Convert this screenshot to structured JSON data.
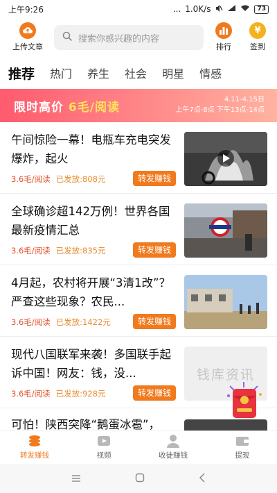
{
  "status_bar": {
    "time": "上午9:26",
    "dots": "...",
    "speed": "1.0K/s",
    "battery": "73"
  },
  "header": {
    "upload_label": "上传文章",
    "search_placeholder": "搜索你感兴趣的内容",
    "rank_label": "排行",
    "sign_label": "签到",
    "sign_symbol": "¥"
  },
  "tabs": [
    "推荐",
    "热门",
    "养生",
    "社会",
    "明星",
    "情感"
  ],
  "banner": {
    "text_prefix": "限时高价 ",
    "text_highlight": "6毛/阅读",
    "date_line": "4.11-4.15日",
    "time_line": "上午7点-8点 下午13点-14点"
  },
  "news": [
    {
      "title": "午间惊险一幕！电瓶车充电突发爆炸，起火",
      "price": "3.6毛/阅读",
      "sent": "已发放:808元",
      "share": "转发赚钱"
    },
    {
      "title": "全球确诊超142万例！世界各国最新疫情汇总",
      "price": "3.6毛/阅读",
      "sent": "已发放:835元",
      "share": "转发赚钱"
    },
    {
      "title": "4月起，农村将开展“3清1改”？严查这些现象？农民...",
      "price": "3.6毛/阅读",
      "sent": "已发放:1422元",
      "share": "转发赚钱"
    },
    {
      "title": "现代八国联军来袭！多国联手起诉中国！网友：钱，没...",
      "price": "3.6毛/阅读",
      "sent": "已发放:928元",
      "share": "转发赚钱",
      "thumb_text": "钱库资讯"
    }
  ],
  "partial_news_title": "可怕！陕西突降“鹅蛋冰雹”，",
  "bottom_nav": [
    "转发赚钱",
    "视频",
    "收徒赚钱",
    "提现"
  ],
  "colors": {
    "accent": "#f07a1e",
    "price": "#e0522b",
    "banner_highlight": "#ffe45b"
  }
}
